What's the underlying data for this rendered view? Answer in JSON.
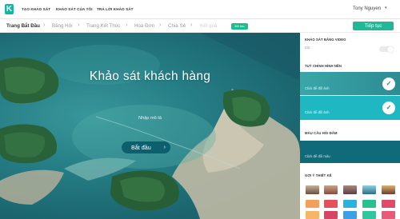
{
  "topnav": {
    "logo_letter": "K",
    "links": [
      "TẠO KHẢO SÁT",
      "KHẢO SÁT CỦA TÔI",
      "TRẢ LỜI KHẢO SÁT"
    ],
    "user_name": "Tony Nguyen",
    "user_caret": "▾"
  },
  "steps": {
    "items": [
      "Trang Bắt Đầu",
      "Bảng Hỏi",
      "Trang Kết Thúc",
      "Hoá Đơn",
      "Chia Sẻ",
      "Kết quả"
    ],
    "separator": "›",
    "mini_badge": "Đã lưu",
    "continue_label": "Tiếp tục"
  },
  "hero": {
    "title": "Khảo sát khách hàng",
    "description": "Nhập mô tả",
    "start_label": "Bắt đầu",
    "start_arrow": "›"
  },
  "panel": {
    "video_section": "KHẢO SÁT BẰNG VIDEO",
    "video_sub": "Bật",
    "bg_section": "TUỲ CHỈNH HÌNH NỀN",
    "bg_image_hint": "Click để đổi ảnh",
    "bg_color_hint": "Click để đổi màu",
    "button_color_section": "MÀU CÂU HỎI ĐÂM",
    "design_section": "GỢI Ý THIẾT KẾ",
    "check_glyph": "✓"
  },
  "colors": {
    "accent": "#22b796",
    "teal_dark": "#0e5f6e",
    "swatches": [
      "#f5a05a",
      "#e84f5d",
      "#d64563",
      "#2bb3e0",
      "#26c28f",
      "#e04b6a"
    ]
  }
}
